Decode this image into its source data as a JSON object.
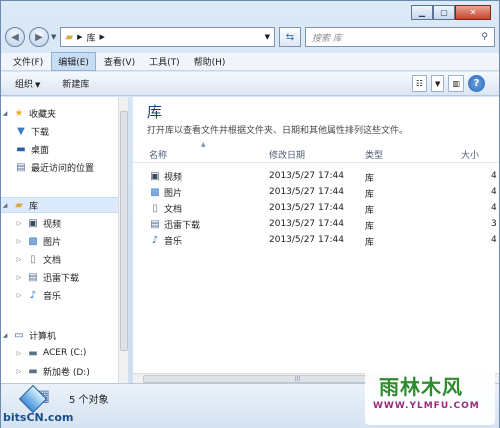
{
  "address": {
    "library_crumb": "库",
    "search_placeholder": "搜索 库"
  },
  "menu": [
    "文件(F)",
    "编辑(E)",
    "查看(V)",
    "工具(T)",
    "帮助(H)"
  ],
  "commands": {
    "organize": "组织",
    "new_library": "新建库"
  },
  "nav": {
    "favorites": "收藏夹",
    "downloads": "下载",
    "desktop": "桌面",
    "recent": "最近访问的位置",
    "libraries": "库",
    "videos": "视频",
    "pictures": "图片",
    "documents": "文档",
    "xunlei": "迅雷下载",
    "music": "音乐",
    "computer": "计算机",
    "drive_c": "ACER (C:)",
    "drive_d": "新加卷 (D:)"
  },
  "content": {
    "title": "库",
    "description": "打开库以查看文件并根据文件夹、日期和其他属性排列这些文件。",
    "columns": {
      "name": "名称",
      "modified": "修改日期",
      "type": "类型",
      "size": "大小"
    },
    "rows": [
      {
        "name": "视频",
        "date": "2013/5/27 17:44",
        "type": "库",
        "size": "4"
      },
      {
        "name": "图片",
        "date": "2013/5/27 17:44",
        "type": "库",
        "size": "4"
      },
      {
        "name": "文档",
        "date": "2013/5/27 17:44",
        "type": "库",
        "size": "4"
      },
      {
        "name": "迅雷下载",
        "date": "2013/5/27 17:44",
        "type": "库",
        "size": "3"
      },
      {
        "name": "音乐",
        "date": "2013/5/27 17:44",
        "type": "库",
        "size": "4"
      }
    ]
  },
  "status": {
    "count": "5 个对象"
  },
  "watermarks": {
    "left": "bitsCN.com",
    "right_big": "雨林木风",
    "right_url": "WWW.YLMFU.COM"
  }
}
